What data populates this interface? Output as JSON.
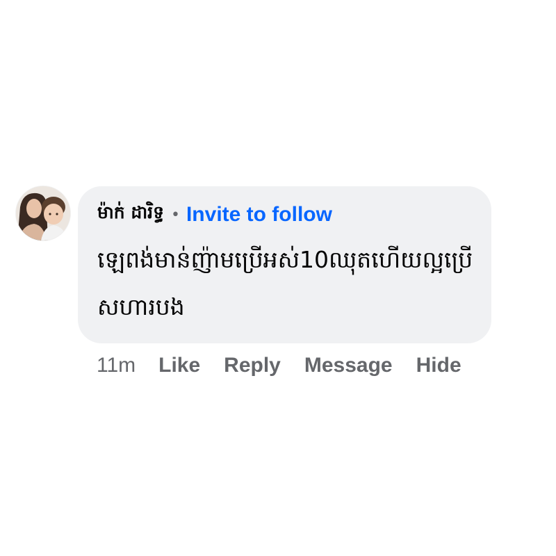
{
  "comment": {
    "author": {
      "name": "ម៉ាក់ ដារិទ្ធ",
      "avatar_icon": "profile-photo"
    },
    "separator": "•",
    "invite_label": "Invite to follow",
    "text": "ឡេពង់មាន់ញ៉ាមប្រើអស់10ឈុតហើយល្អប្រើសហារបង"
  },
  "actions": {
    "timestamp": "11m",
    "like_label": "Like",
    "reply_label": "Reply",
    "message_label": "Message",
    "hide_label": "Hide"
  },
  "colors": {
    "bubble_bg": "#f0f1f3",
    "link_blue": "#0866ff",
    "muted_gray": "#65676b",
    "text_dark": "#050505"
  }
}
